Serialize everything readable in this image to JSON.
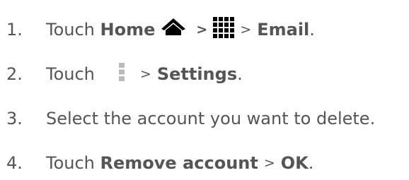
{
  "steps": [
    {
      "number": "1.",
      "parts": {
        "verb": "Touch",
        "home": "Home",
        "sep1": ">",
        "sep2": ">",
        "email": "Email",
        "end": "."
      },
      "icons": [
        "home-icon",
        "apps-grid-icon"
      ]
    },
    {
      "number": "2.",
      "parts": {
        "verb": "Touch",
        "sep1": ">",
        "settings": "Settings",
        "end": "."
      },
      "icons": [
        "menu-overflow-icon"
      ]
    },
    {
      "number": "3.",
      "parts": {
        "text": "Select the account you want to delete."
      }
    },
    {
      "number": "4.",
      "parts": {
        "verb": "Touch",
        "remove": "Remove account",
        "sep1": ">",
        "ok": "OK",
        "end": "."
      }
    }
  ],
  "colors": {
    "text": "#555555",
    "icon": "#000000",
    "menu_icon": "#bbbbbb"
  }
}
